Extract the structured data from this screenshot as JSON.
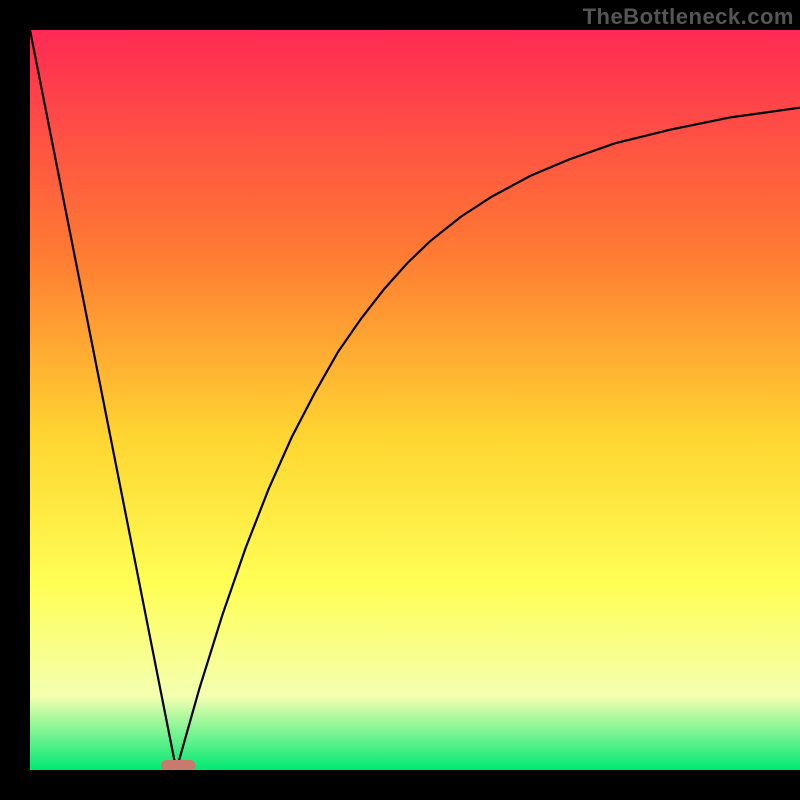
{
  "watermark": "TheBottleneck.com",
  "colors": {
    "frame": "#000000",
    "gradient_top": "#ff2a54",
    "gradient_mid1": "#ff7a33",
    "gradient_mid2": "#ffd531",
    "gradient_mid3": "#ffff55",
    "gradient_mid4": "#f4ffb0",
    "gradient_bottom": "#00e874",
    "curve": "#000000",
    "marker_fill": "#c97a6f",
    "marker_stroke": "#c97a6f"
  },
  "chart_data": {
    "type": "line",
    "title": "",
    "xlabel": "",
    "ylabel": "",
    "xlim": [
      0,
      1
    ],
    "ylim": [
      0,
      1
    ],
    "series": [
      {
        "name": "left-line",
        "x": [
          0.0,
          0.19
        ],
        "y": [
          1.0,
          0.0
        ]
      },
      {
        "name": "right-curve",
        "x": [
          0.19,
          0.22,
          0.25,
          0.28,
          0.31,
          0.34,
          0.37,
          0.4,
          0.43,
          0.46,
          0.49,
          0.52,
          0.56,
          0.6,
          0.65,
          0.7,
          0.76,
          0.83,
          0.91,
          1.0
        ],
        "y": [
          0.0,
          0.11,
          0.21,
          0.3,
          0.38,
          0.45,
          0.51,
          0.565,
          0.61,
          0.65,
          0.685,
          0.715,
          0.748,
          0.775,
          0.803,
          0.825,
          0.847,
          0.865,
          0.882,
          0.895
        ]
      }
    ],
    "marker": {
      "x_range": [
        0.17,
        0.215
      ],
      "y": 0.006,
      "rx": 0.007
    },
    "legend": null,
    "grid": false
  }
}
